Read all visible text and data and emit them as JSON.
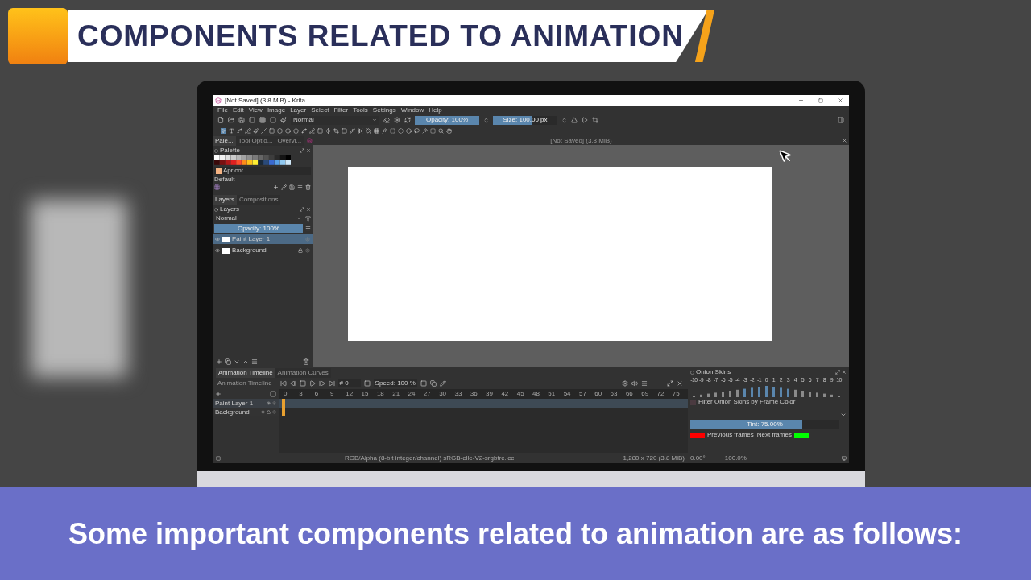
{
  "banner": {
    "title": "COMPONENTS RELATED TO ANIMATION"
  },
  "app": {
    "title": "[Not Saved]  (3.8 MiB) - Krita",
    "menu": [
      "File",
      "Edit",
      "View",
      "Image",
      "Layer",
      "Select",
      "Filter",
      "Tools",
      "Settings",
      "Window",
      "Help"
    ],
    "toolbar": {
      "blend_mode": "Normal",
      "opacity": {
        "label": "Opacity: 100%",
        "level": 1
      },
      "size": {
        "label": "Size: 100.00 px",
        "level": 0.6
      }
    },
    "docker_tabs": [
      {
        "label": "Pale...",
        "selected": true
      },
      {
        "label": "Tool Optio...",
        "selected": false
      },
      {
        "label": "Overvi...",
        "selected": false
      }
    ],
    "palette": {
      "title": "Palette",
      "current": "Apricot",
      "set": "Default"
    },
    "layer_tabs": [
      {
        "label": "Layers",
        "selected": true
      },
      {
        "label": "Compositions",
        "selected": false
      }
    ],
    "layers": {
      "title": "Layers",
      "blend_mode": "Normal",
      "opacity": {
        "label": "Opacity:  100%",
        "level": 1
      },
      "items": [
        {
          "name": "Paint Layer 1",
          "selected": true,
          "locked": false
        },
        {
          "name": "Background",
          "selected": false,
          "locked": true
        }
      ]
    },
    "document": {
      "title": "[Not Saved]  (3.8 MiB)"
    },
    "animation": {
      "tabs": [
        {
          "label": "Animation Timeline",
          "selected": true
        },
        {
          "label": "Animation Curves",
          "selected": false
        }
      ],
      "title": "Animation Timeline",
      "frame": "# 0",
      "speed": "Speed: 100 %",
      "frames": [
        "0",
        "3",
        "6",
        "9",
        "12",
        "15",
        "18",
        "21",
        "24",
        "27",
        "30",
        "33",
        "36",
        "39",
        "42",
        "45",
        "48",
        "51",
        "54",
        "57",
        "60",
        "63",
        "66",
        "69",
        "72",
        "75"
      ],
      "layers": [
        {
          "name": "Paint Layer 1",
          "selected": true,
          "locked": false
        },
        {
          "name": "Background",
          "selected": false,
          "locked": true
        }
      ]
    },
    "onion_skins": {
      "title": "Onion Skins",
      "offsets": [
        "-10",
        "-9",
        "-8",
        "-7",
        "-6",
        "-5",
        "-4",
        "-3",
        "-2",
        "-1",
        "0",
        "1",
        "2",
        "3",
        "4",
        "5",
        "6",
        "7",
        "8",
        "9",
        "10"
      ],
      "filter_label": "Filter Onion Skins by Frame Color",
      "filter_checked": false,
      "tint": {
        "label": "Tint: 75.00%",
        "level": 0.75
      },
      "frame_colors": [
        {
          "label": "Previous frames",
          "color": "#ff0000"
        },
        {
          "label": "Next frames",
          "color": "#00ff00"
        }
      ]
    },
    "status": {
      "color_space": "RGB/Alpha (8-bit integer/channel)  sRGB-elle-V2-srgbtrc.icc",
      "dimensions": "1,280 x 720 (3.8 MiB)",
      "rotation": "0.00°",
      "zoom": "100.0%"
    }
  },
  "caption": "Some important components related to animation are as follows:"
}
